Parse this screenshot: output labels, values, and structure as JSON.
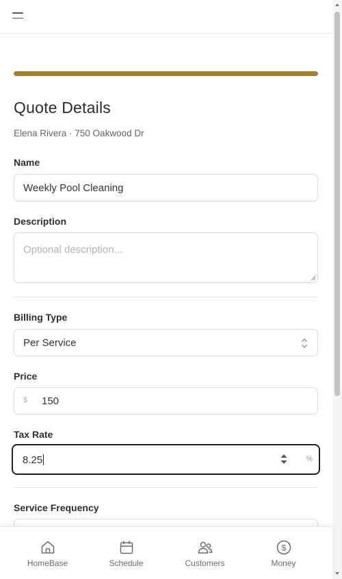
{
  "header": {
    "menu_icon": "hamburger-icon"
  },
  "progress": {
    "percent": 100,
    "color": "#a47f2d"
  },
  "page": {
    "title": "Quote Details",
    "subtitle": "Elena Rivera · 750 Oakwood Dr"
  },
  "form": {
    "name": {
      "label": "Name",
      "value": "Weekly Pool Cleaning"
    },
    "description": {
      "label": "Description",
      "placeholder": "Optional description..."
    },
    "billing_type": {
      "label": "Billing Type",
      "value": "Per Service"
    },
    "price": {
      "label": "Price",
      "prefix": "$",
      "value": "150"
    },
    "tax_rate": {
      "label": "Tax Rate",
      "value": "8.25",
      "suffix": "%"
    },
    "service_frequency": {
      "label": "Service Frequency"
    }
  },
  "bottom_nav": {
    "items": [
      {
        "label": "HomeBase",
        "icon": "home-icon"
      },
      {
        "label": "Schedule",
        "icon": "calendar-icon"
      },
      {
        "label": "Customers",
        "icon": "users-icon"
      },
      {
        "label": "Money",
        "icon": "dollar-circle-icon"
      }
    ]
  }
}
